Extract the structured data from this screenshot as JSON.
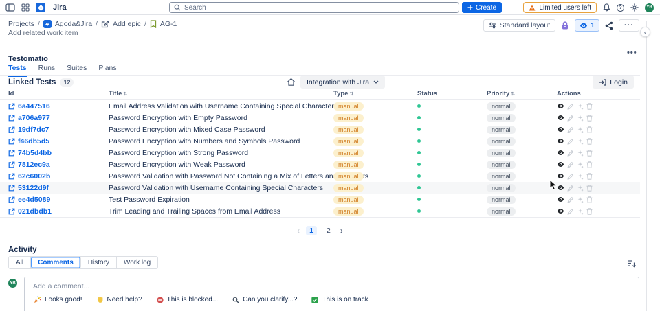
{
  "topbar": {
    "app_name": "Jira",
    "search_placeholder": "Search",
    "create_label": "Create",
    "limited_users_label": "Limited users left",
    "avatar_initials": "YB"
  },
  "breadcrumb": {
    "projects": "Projects",
    "project": "Agoda&Jira",
    "add_epic": "Add epic",
    "issue": "AG-1"
  },
  "toolbar": {
    "standard_layout_label": "Standard layout",
    "watch_count": "1"
  },
  "add_related_label": "Add related work item",
  "panel": {
    "title": "Testomatio",
    "tabs": [
      "Tests",
      "Runs",
      "Suites",
      "Plans"
    ],
    "active_tab": "Tests",
    "linked_tests_label": "Linked Tests",
    "linked_tests_count": "12",
    "integration_dropdown": "Integration with Jira",
    "login_label": "Login",
    "more_label": "•••"
  },
  "table": {
    "columns": [
      "Id",
      "Title",
      "Type",
      "Status",
      "Priority",
      "Actions"
    ],
    "hovered_row_id": "53122d9f",
    "rows": [
      {
        "id": "6a447516",
        "title": "Email Address Validation with Username Containing Special Characters",
        "type": "manual",
        "status": "passed",
        "priority": "normal"
      },
      {
        "id": "a706a977",
        "title": "Password Encryption with Empty Password",
        "type": "manual",
        "status": "passed",
        "priority": "normal"
      },
      {
        "id": "19df7dc7",
        "title": "Password Encryption with Mixed Case Password",
        "type": "manual",
        "status": "passed",
        "priority": "normal"
      },
      {
        "id": "f46db5d5",
        "title": "Password Encryption with Numbers and Symbols Password",
        "type": "manual",
        "status": "passed",
        "priority": "normal"
      },
      {
        "id": "74b5d4bb",
        "title": "Password Encryption with Strong Password",
        "type": "manual",
        "status": "passed",
        "priority": "normal"
      },
      {
        "id": "7812ec9a",
        "title": "Password Encryption with Weak Password",
        "type": "manual",
        "status": "passed",
        "priority": "normal"
      },
      {
        "id": "62c6002b",
        "title": "Password Validation with Password Not Containing a Mix of Letters and Numbers",
        "type": "manual",
        "status": "passed",
        "priority": "normal"
      },
      {
        "id": "53122d9f",
        "title": "Password Validation with Username Containing Special Characters",
        "type": "manual",
        "status": "passed",
        "priority": "normal"
      },
      {
        "id": "ee4d5089",
        "title": "Test Password Expiration",
        "type": "manual",
        "status": "passed",
        "priority": "normal"
      },
      {
        "id": "021dbdb1",
        "title": "Trim Leading and Trailing Spaces from Email Address",
        "type": "manual",
        "status": "passed",
        "priority": "normal"
      }
    ]
  },
  "pagination": {
    "prev": "‹",
    "pages": [
      "1",
      "2"
    ],
    "active_page": "1",
    "next": "›"
  },
  "activity": {
    "title": "Activity",
    "tabs": [
      "All",
      "Comments",
      "History",
      "Work log"
    ],
    "active_tab": "Comments",
    "comment_placeholder": "Add a comment...",
    "quick_replies": [
      {
        "icon": "party-popper",
        "label": "Looks good!"
      },
      {
        "icon": "wave-hand",
        "label": "Need help?"
      },
      {
        "icon": "blocked",
        "label": "This is blocked..."
      },
      {
        "icon": "magnifier",
        "label": "Can you clarify...?"
      },
      {
        "icon": "check",
        "label": "This is on track"
      }
    ]
  },
  "colors": {
    "accent": "#0c66e4",
    "warning": "#e56910",
    "lock_purple": "#8270db",
    "status_green": "#2fc694",
    "manual_bg": "#fcf0cd",
    "manual_text": "#cf7b1e",
    "avatar_green": "#1f845a"
  }
}
